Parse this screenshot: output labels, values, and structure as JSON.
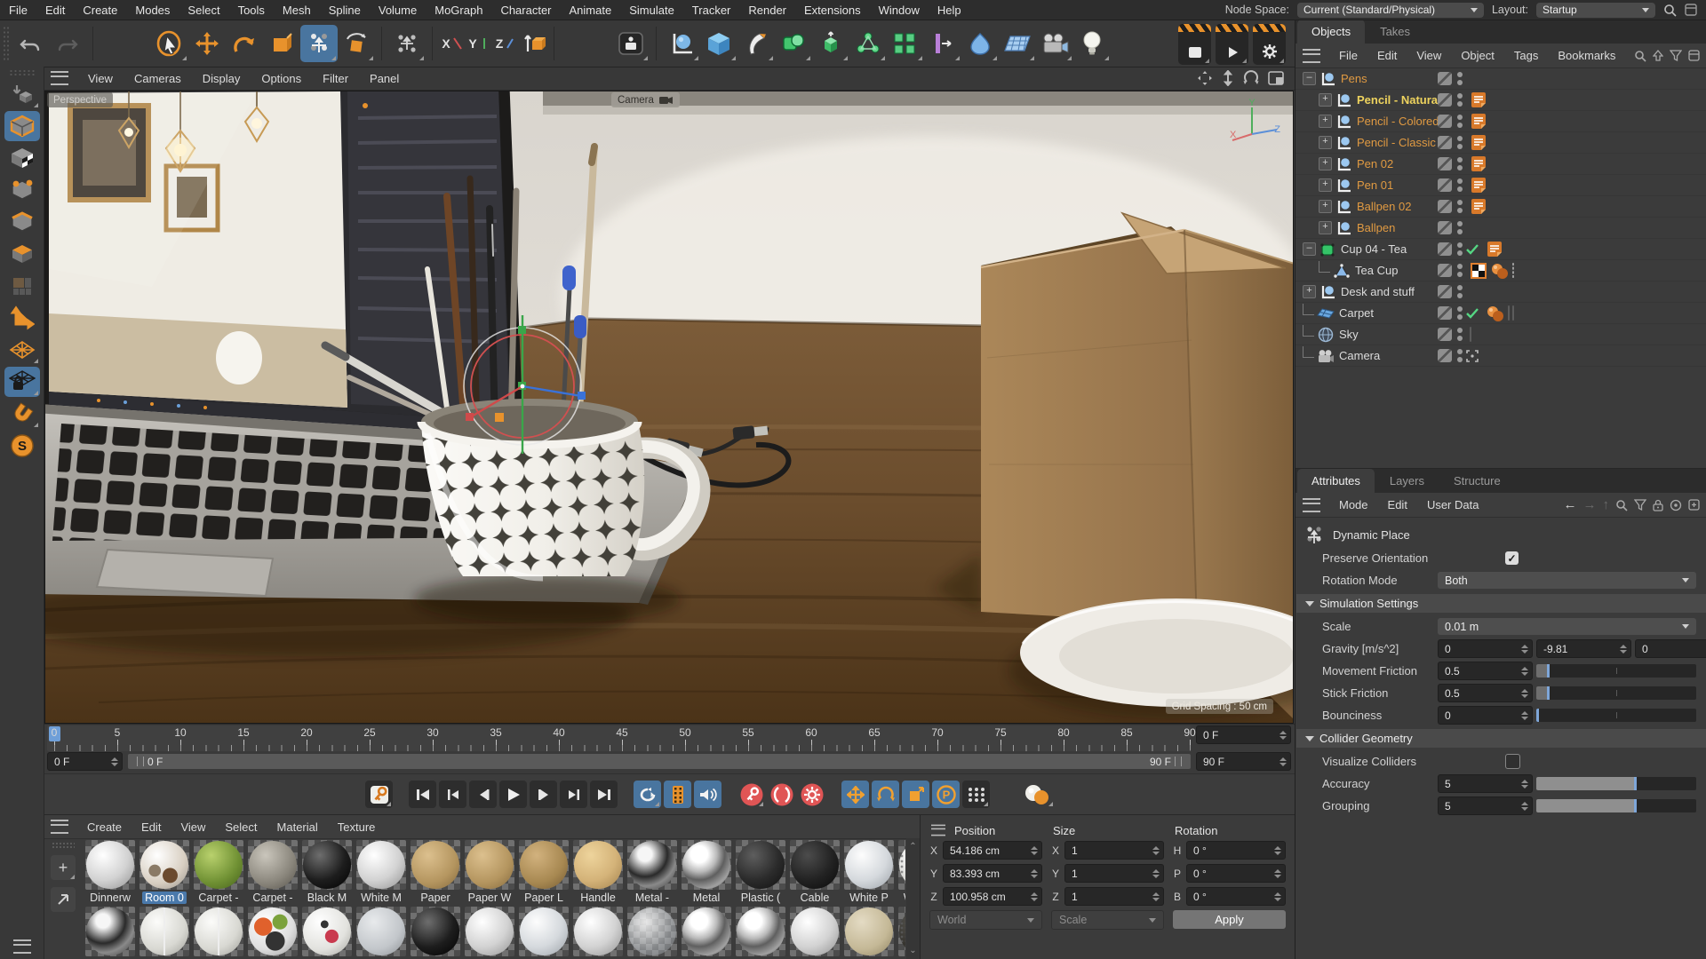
{
  "colors": {
    "accent_blue": "#4a79ab",
    "highlight_orange": "#e8922c",
    "object_orange": "#e09a42",
    "object_yellow": "#eed35e",
    "check_green": "#55d683",
    "record_red": "#e05555"
  },
  "menubar": {
    "items": [
      "File",
      "Edit",
      "Create",
      "Modes",
      "Select",
      "Tools",
      "Mesh",
      "Spline",
      "Volume",
      "MoGraph",
      "Character",
      "Animate",
      "Simulate",
      "Tracker",
      "Render",
      "Extensions",
      "Window",
      "Help"
    ],
    "node_space_label": "Node Space:",
    "node_space_value": "Current (Standard/Physical)",
    "layout_label": "Layout:",
    "layout_value": "Startup"
  },
  "toolbar": {
    "axis_x": "X",
    "axis_y": "Y",
    "axis_z": "Z"
  },
  "viewport": {
    "menu": [
      "View",
      "Cameras",
      "Display",
      "Options",
      "Filter",
      "Panel"
    ],
    "perspective_label": "Perspective",
    "camera_label": "Camera",
    "grid_spacing_label": "Grid Spacing : 50 cm",
    "axis_x": "X",
    "axis_y": "Y",
    "axis_z": "Z"
  },
  "timeline": {
    "tick_values": [
      0,
      5,
      10,
      15,
      20,
      25,
      30,
      35,
      40,
      45,
      50,
      55,
      60,
      65,
      70,
      75,
      80,
      85,
      90
    ],
    "current_frame": "0 F",
    "range_start": "0 F",
    "range_end": "90 F",
    "start_frame": "0 F",
    "end_frame": "90 F"
  },
  "object_manager": {
    "tabs": [
      "Objects",
      "Takes"
    ],
    "menu": [
      "File",
      "Edit",
      "View",
      "Object",
      "Tags",
      "Bookmarks"
    ],
    "items": [
      {
        "name": "Pens",
        "color": "c-orange",
        "depth": 0,
        "exp": "minus",
        "icon": "null",
        "tags": []
      },
      {
        "name": "Pencil - Natural",
        "color": "c-yellow",
        "depth": 1,
        "exp": "plus",
        "icon": "null",
        "tags": [
          "note"
        ]
      },
      {
        "name": "Pencil - Colored",
        "color": "c-orange",
        "depth": 1,
        "exp": "plus",
        "icon": "null",
        "tags": [
          "note"
        ]
      },
      {
        "name": "Pencil - Classic",
        "color": "c-orange",
        "depth": 1,
        "exp": "plus",
        "icon": "null",
        "tags": [
          "note"
        ]
      },
      {
        "name": "Pen 02",
        "color": "c-orange",
        "depth": 1,
        "exp": "plus",
        "icon": "null",
        "tags": [
          "note"
        ]
      },
      {
        "name": "Pen 01",
        "color": "c-orange",
        "depth": 1,
        "exp": "plus",
        "icon": "null",
        "tags": [
          "note"
        ]
      },
      {
        "name": "Ballpen 02",
        "color": "c-orange",
        "depth": 1,
        "exp": "plus",
        "icon": "null",
        "tags": [
          "note"
        ]
      },
      {
        "name": "Ballpen",
        "color": "c-orange",
        "depth": 1,
        "exp": "plus",
        "icon": "null",
        "tags": []
      },
      {
        "name": "Cup 04 - Tea",
        "color": "c-white",
        "depth": 0,
        "exp": "minus",
        "icon": "cube",
        "check": true,
        "tags": [
          "note"
        ]
      },
      {
        "name": "Tea Cup",
        "color": "c-white",
        "depth": 1,
        "exp": "branch",
        "icon": "poly",
        "tags": [
          "uvw",
          "phong",
          "mat-white"
        ]
      },
      {
        "name": "Desk and stuff",
        "color": "c-white",
        "depth": 0,
        "exp": "plus",
        "icon": "null",
        "tags": []
      },
      {
        "name": "Carpet",
        "color": "c-white",
        "depth": 0,
        "exp": "branch",
        "icon": "plane",
        "check": true,
        "tags": [
          "phong",
          "mat-carpet",
          "mat-green"
        ]
      },
      {
        "name": "Sky",
        "color": "c-white",
        "depth": 0,
        "exp": "branch",
        "icon": "sky",
        "tags": [
          "mat-sky"
        ]
      },
      {
        "name": "Camera",
        "color": "c-white",
        "depth": 0,
        "exp": "branch",
        "icon": "camera",
        "focus": true,
        "tags": []
      }
    ]
  },
  "materials": {
    "menu": [
      "Create",
      "Edit",
      "View",
      "Select",
      "Material",
      "Texture"
    ],
    "row1": [
      {
        "label": "Dinnerw",
        "style": "white"
      },
      {
        "label": "Room 0",
        "style": "room",
        "selected": true
      },
      {
        "label": "Carpet -",
        "style": "green"
      },
      {
        "label": "Carpet -",
        "style": "knit"
      },
      {
        "label": "Black M",
        "style": "black"
      },
      {
        "label": "White M",
        "style": "white"
      },
      {
        "label": "Paper",
        "style": "tan"
      },
      {
        "label": "Paper W",
        "style": "tan"
      },
      {
        "label": "Paper L",
        "style": "tan2"
      },
      {
        "label": "Handle",
        "style": "wood"
      },
      {
        "label": "Metal -",
        "style": "chrome2"
      },
      {
        "label": "Metal",
        "style": "chrome"
      },
      {
        "label": "Plastic (",
        "style": "dark"
      },
      {
        "label": "Cable",
        "style": "darker"
      },
      {
        "label": "White P",
        "style": "white2"
      },
      {
        "label": "White C",
        "style": "dotted"
      }
    ],
    "row2_styles": [
      "chrome2",
      "label",
      "label",
      "multi",
      "print",
      "gray",
      "black",
      "white",
      "white2",
      "white",
      "glass",
      "chrome",
      "chrome",
      "white",
      "beige",
      "darktex"
    ]
  },
  "coordinates": {
    "position": {
      "header": "Position",
      "x_label": "X",
      "x": "54.186 cm",
      "y_label": "Y",
      "y": "83.393 cm",
      "z_label": "Z",
      "z": "100.958 cm",
      "footer": "World"
    },
    "size": {
      "header": "Size",
      "x_label": "X",
      "x": "1",
      "y_label": "Y",
      "y": "1",
      "z_label": "Z",
      "z": "1",
      "footer": "Scale"
    },
    "rotation": {
      "header": "Rotation",
      "h_label": "H",
      "h": "0 °",
      "p_label": "P",
      "p": "0 °",
      "b_label": "B",
      "b": "0 °",
      "apply_label": "Apply"
    }
  },
  "attributes": {
    "tabs": [
      "Attributes",
      "Layers",
      "Structure"
    ],
    "menu": [
      "Mode",
      "Edit",
      "User Data"
    ],
    "object_title": "Dynamic Place",
    "preserve_orientation_label": "Preserve Orientation",
    "rotation_mode_label": "Rotation Mode",
    "rotation_mode_value": "Both",
    "simulation_header": "Simulation Settings",
    "scale_label": "Scale",
    "scale_value": "0.01 m",
    "gravity_label": "Gravity [m/s^2]",
    "gravity_x": "0",
    "gravity_y": "-9.81",
    "gravity_z": "0",
    "movement_friction_label": "Movement Friction",
    "movement_friction": "0.5",
    "stick_friction_label": "Stick Friction",
    "stick_friction": "0.5",
    "bounciness_label": "Bounciness",
    "bounciness": "0",
    "collider_header": "Collider Geometry",
    "visualize_colliders_label": "Visualize Colliders",
    "accuracy_label": "Accuracy",
    "accuracy": "5",
    "grouping_label": "Grouping",
    "grouping": "5"
  }
}
